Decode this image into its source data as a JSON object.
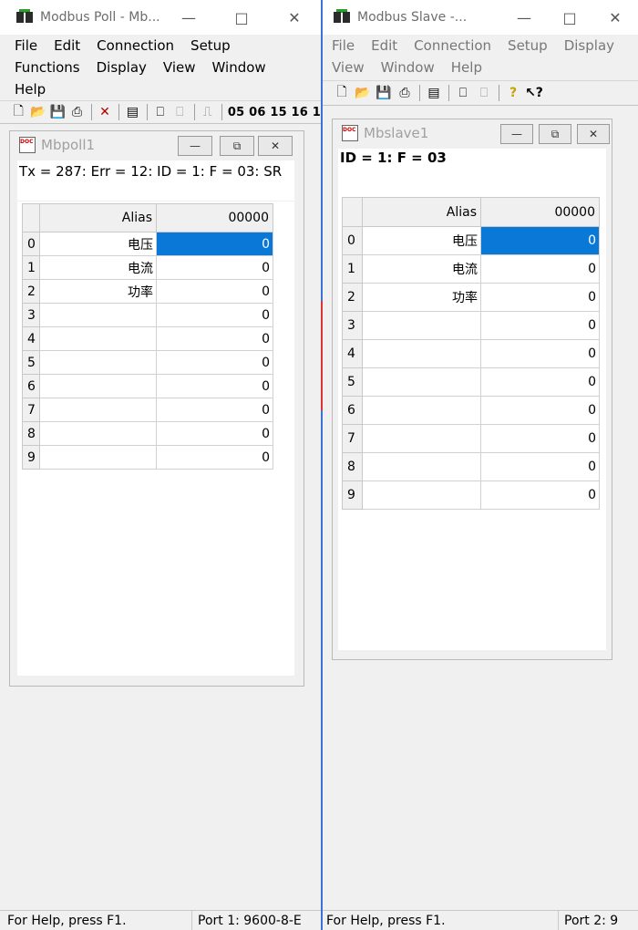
{
  "poll": {
    "title": "Modbus Poll - Mb...",
    "menu_row1": [
      "File",
      "Edit",
      "Connection",
      "Setup"
    ],
    "menu_row2": [
      "Functions",
      "Display",
      "View",
      "Window"
    ],
    "menu_row3": [
      "Help"
    ],
    "toolbar_codes": "05 06 15 16 1",
    "child": {
      "title": "Mbpoll1",
      "status": "Tx = 287: Err = 12: ID = 1: F = 03: SR",
      "col_alias": "Alias",
      "col_addr": "00000",
      "rows": [
        {
          "idx": "0",
          "alias": "电压",
          "value": "0"
        },
        {
          "idx": "1",
          "alias": "电流",
          "value": "0"
        },
        {
          "idx": "2",
          "alias": "功率",
          "value": "0"
        },
        {
          "idx": "3",
          "alias": "",
          "value": "0"
        },
        {
          "idx": "4",
          "alias": "",
          "value": "0"
        },
        {
          "idx": "5",
          "alias": "",
          "value": "0"
        },
        {
          "idx": "6",
          "alias": "",
          "value": "0"
        },
        {
          "idx": "7",
          "alias": "",
          "value": "0"
        },
        {
          "idx": "8",
          "alias": "",
          "value": "0"
        },
        {
          "idx": "9",
          "alias": "",
          "value": "0"
        }
      ]
    },
    "statusbar_help": "For Help, press F1.",
    "statusbar_port": "Port 1: 9600-8-E"
  },
  "slave": {
    "title": "Modbus Slave -...",
    "menu_row1": [
      "File",
      "Edit",
      "Connection",
      "Setup",
      "Display"
    ],
    "menu_row2": [
      "View",
      "Window",
      "Help"
    ],
    "child": {
      "title": "Mbslave1",
      "status": "ID = 1: F = 03",
      "col_alias": "Alias",
      "col_addr": "00000",
      "rows": [
        {
          "idx": "0",
          "alias": "电压",
          "value": "0"
        },
        {
          "idx": "1",
          "alias": "电流",
          "value": "0"
        },
        {
          "idx": "2",
          "alias": "功率",
          "value": "0"
        },
        {
          "idx": "3",
          "alias": "",
          "value": "0"
        },
        {
          "idx": "4",
          "alias": "",
          "value": "0"
        },
        {
          "idx": "5",
          "alias": "",
          "value": "0"
        },
        {
          "idx": "6",
          "alias": "",
          "value": "0"
        },
        {
          "idx": "7",
          "alias": "",
          "value": "0"
        },
        {
          "idx": "8",
          "alias": "",
          "value": "0"
        },
        {
          "idx": "9",
          "alias": "",
          "value": "0"
        }
      ]
    },
    "statusbar_help": "For Help, press F1.",
    "statusbar_port": "Port 2: 9"
  },
  "colors": {
    "selection": "#0a78d7",
    "taskbar_accent": "#2f6fe0"
  }
}
